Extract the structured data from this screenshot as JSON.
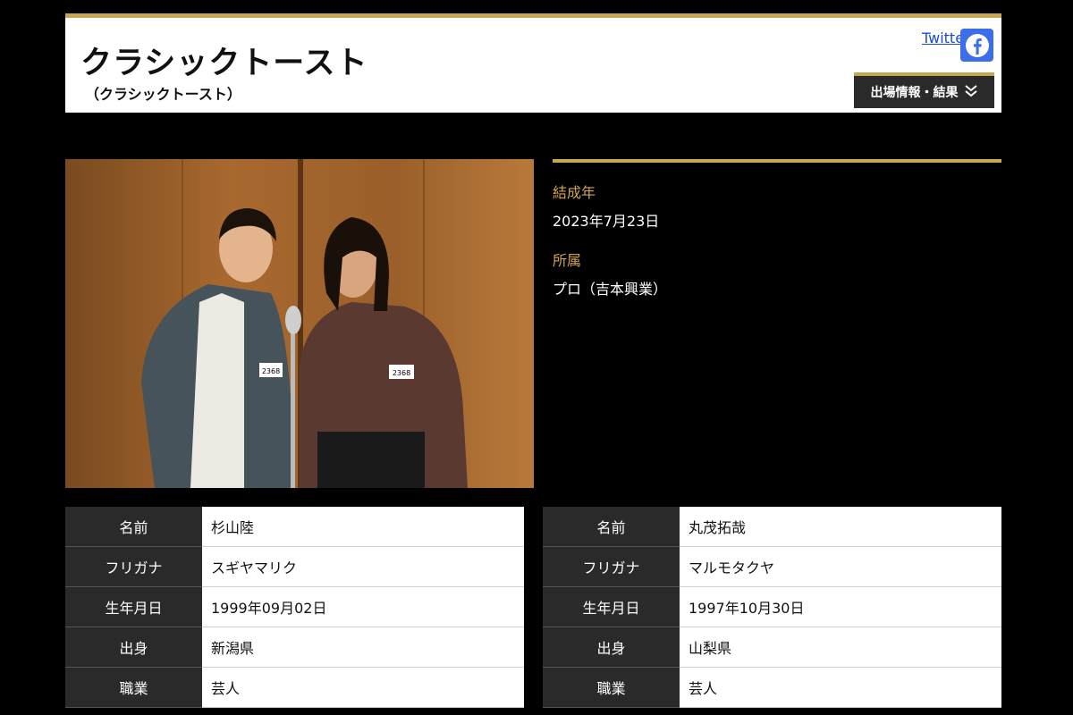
{
  "header": {
    "title": "クラシックトースト",
    "subtitle": "（クラシックトースト）",
    "twitter_label": "Twitter",
    "dropdown_label": "出場情報・結果"
  },
  "photo": {
    "badge_left": "2368",
    "badge_right": "2368"
  },
  "info": {
    "formed_label": "結成年",
    "formed_value": "2023年7月23日",
    "affiliation_label": "所属",
    "affiliation_value": "プロ（吉本興業）"
  },
  "members": [
    {
      "rows": [
        {
          "key": "名前",
          "value": "杉山陸"
        },
        {
          "key": "フリガナ",
          "value": "スギヤマリク"
        },
        {
          "key": "生年月日",
          "value": "1999年09月02日"
        },
        {
          "key": "出身",
          "value": "新潟県"
        },
        {
          "key": "職業",
          "value": "芸人"
        }
      ]
    },
    {
      "rows": [
        {
          "key": "名前",
          "value": "丸茂拓哉"
        },
        {
          "key": "フリガナ",
          "value": "マルモタクヤ"
        },
        {
          "key": "生年月日",
          "value": "1997年10月30日"
        },
        {
          "key": "出身",
          "value": "山梨県"
        },
        {
          "key": "職業",
          "value": "芸人"
        }
      ]
    }
  ],
  "colors": {
    "accent": "#c8a752",
    "label_gold": "#d0a54e",
    "dark_cell": "#2a2a2a",
    "facebook": "#3b6ee8"
  }
}
